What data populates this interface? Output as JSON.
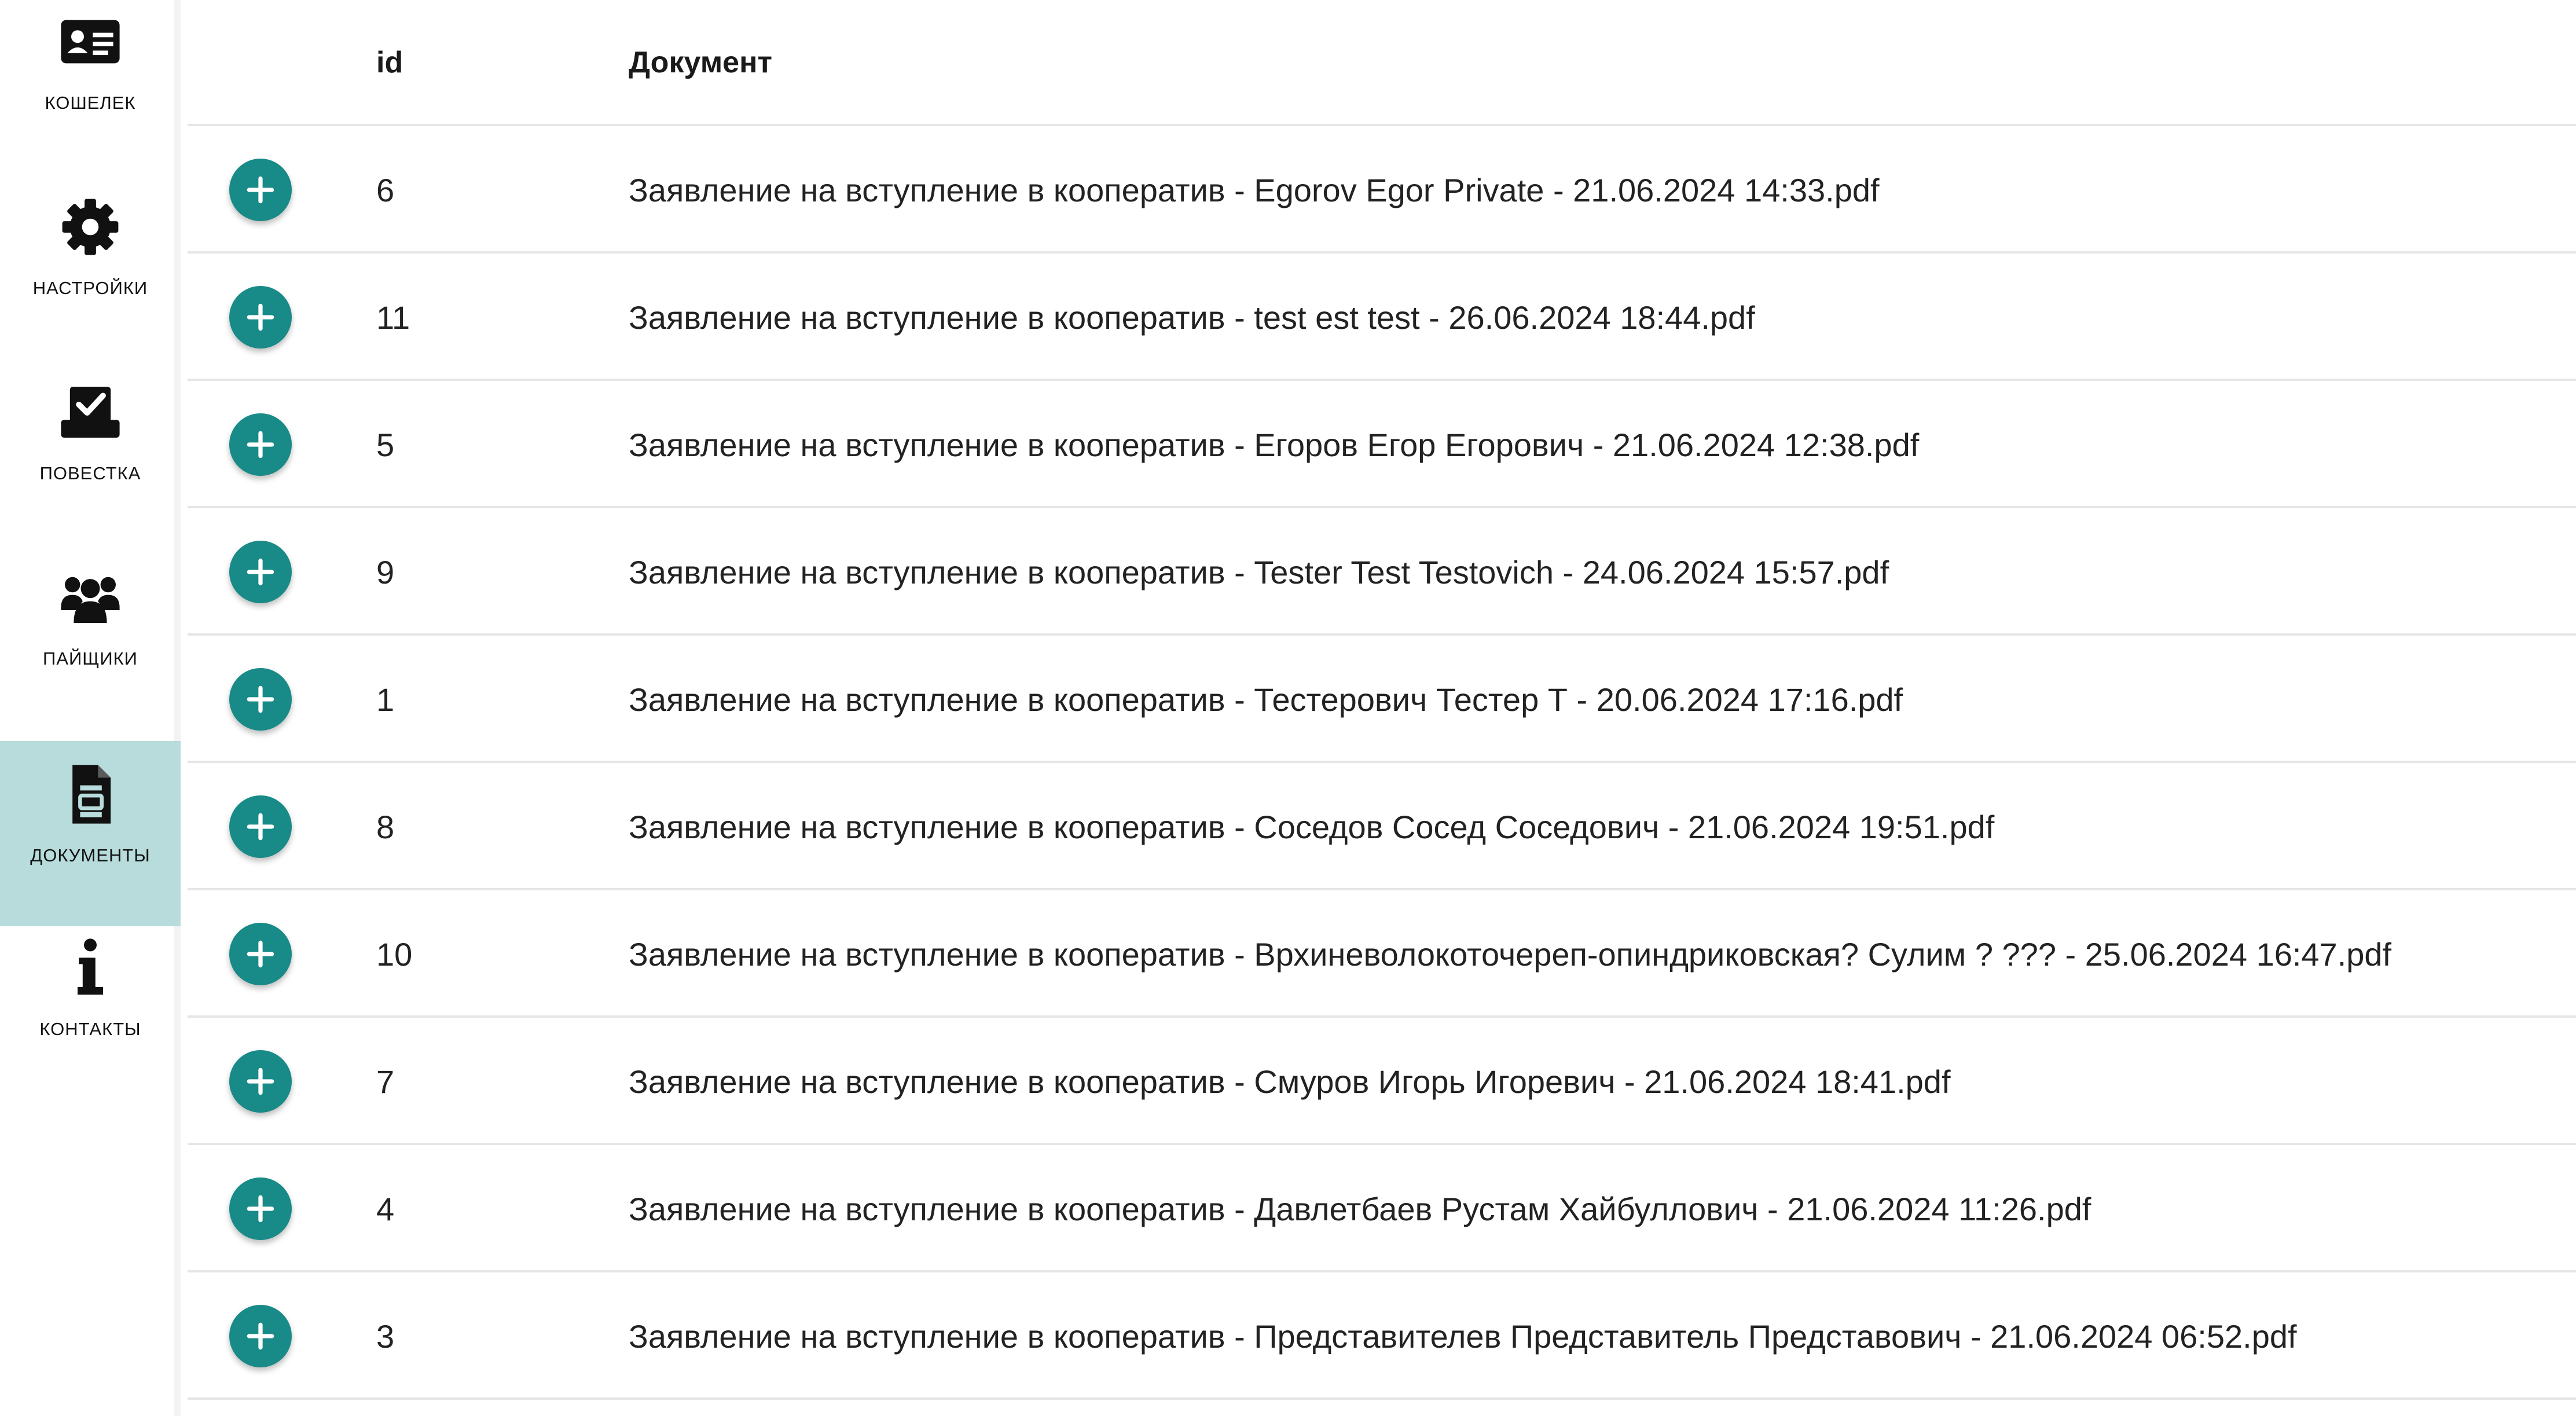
{
  "sidebar": {
    "items": [
      {
        "label": "КОШЕЛЕК",
        "icon": "wallet-id-card-icon",
        "active": false
      },
      {
        "label": "НАСТРОЙКИ",
        "icon": "gear-icon",
        "active": false
      },
      {
        "label": "ПОВЕСТКА",
        "icon": "ballot-check-icon",
        "active": false
      },
      {
        "label": "ПАЙЩИКИ",
        "icon": "people-group-icon",
        "active": false
      },
      {
        "label": "ДОКУМЕНТЫ",
        "icon": "document-icon",
        "active": true
      },
      {
        "label": "КОНТАКТЫ",
        "icon": "info-icon",
        "active": false
      }
    ],
    "active_color": "#b7dcdb"
  },
  "table": {
    "headers": {
      "id": "id",
      "document": "Документ"
    },
    "rows": [
      {
        "id": "6",
        "document": "Заявление на вступление в кооператив - Egorov Egor Private - 21.06.2024 14:33.pdf"
      },
      {
        "id": "11",
        "document": "Заявление на вступление в кооператив - test est test - 26.06.2024 18:44.pdf"
      },
      {
        "id": "5",
        "document": "Заявление на вступление в кооператив - Егоров Егор Егорович - 21.06.2024 12:38.pdf"
      },
      {
        "id": "9",
        "document": "Заявление на вступление в кооператив - Tester Test Testovich - 24.06.2024 15:57.pdf"
      },
      {
        "id": "1",
        "document": "Заявление на вступление в кооператив - Тестерович Тестер Т - 20.06.2024 17:16.pdf"
      },
      {
        "id": "8",
        "document": "Заявление на вступление в кооператив - Соседов Сосед Соседович - 21.06.2024 19:51.pdf"
      },
      {
        "id": "10",
        "document": "Заявление на вступление в кооператив - Врхиневолокоточереп-опиндриковская? Сулим ? ??? - 25.06.2024 16:47.pdf"
      },
      {
        "id": "7",
        "document": "Заявление на вступление в кооператив - Смуров Игорь Игоревич - 21.06.2024 18:41.pdf"
      },
      {
        "id": "4",
        "document": "Заявление на вступление в кооператив - Давлетбаев Рустам Хайбуллович - 21.06.2024 11:26.pdf"
      },
      {
        "id": "3",
        "document": "Заявление на вступление в кооператив - Представителев Представитель Представович - 21.06.2024 06:52.pdf"
      }
    ],
    "row_action_icon": "plus-icon",
    "accent_color": "#188a87"
  }
}
